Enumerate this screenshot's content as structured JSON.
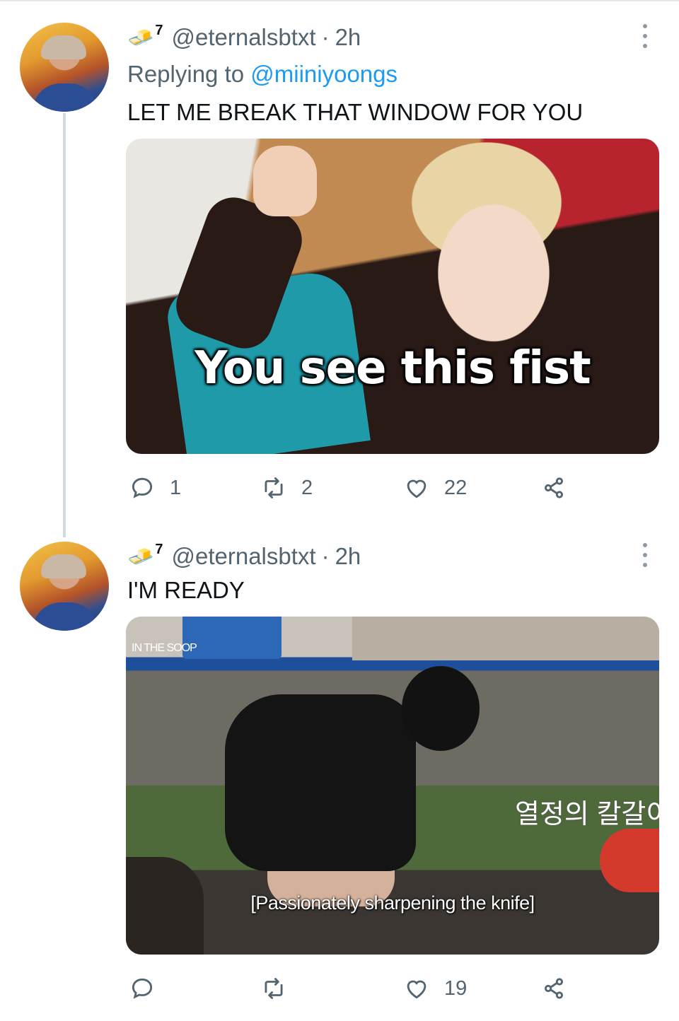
{
  "tweets": [
    {
      "emoji": "🧈",
      "badge": "7",
      "handle": "@eternalsbtxt",
      "separator": "·",
      "time": "2h",
      "replying_prefix": "Replying to ",
      "replying_to": "@miiniyoongs",
      "text": "LET ME BREAK THAT WINDOW FOR YOU",
      "media": {
        "caption": "You see this fist"
      },
      "actions": {
        "reply": "1",
        "retweet": "2",
        "like": "22"
      }
    },
    {
      "emoji": "🧈",
      "badge": "7",
      "handle": "@eternalsbtxt",
      "separator": "·",
      "time": "2h",
      "text": "I'M READY",
      "media": {
        "logo": "IN THE SOOP",
        "korean_text": "열정의 칼갈이",
        "subtitle": "[Passionately sharpening the knife]"
      },
      "actions": {
        "reply": "",
        "retweet": "",
        "like": "19"
      }
    }
  ]
}
